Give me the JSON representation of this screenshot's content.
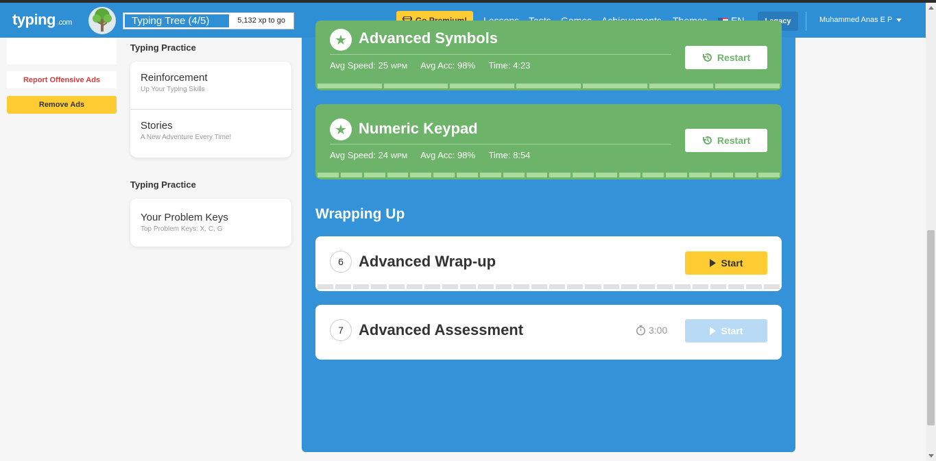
{
  "header": {
    "logo_main": "typing",
    "logo_suffix": ".com",
    "level_name": "Typing Tree (4/5)",
    "xp_progress": 0.63,
    "xp_to_go": "5,132 xp to go",
    "premium_label": "Go Premium!",
    "nav": [
      "Lessons",
      "Tests",
      "Games",
      "Achievements",
      "Themes"
    ],
    "active_nav": "Lessons",
    "language": "EN",
    "legacy_label": "Legacy",
    "user_name": "Muhammed Anas E P"
  },
  "sidebar": {
    "report_ads": "Report Offensive Ads",
    "remove_ads": "Remove Ads"
  },
  "practice": {
    "section1_label": "Typing Practice",
    "items1": [
      {
        "title": "Reinforcement",
        "subtitle": "Up Your Typing Skills"
      },
      {
        "title": "Stories",
        "subtitle": "A New Adventure Every Time!"
      }
    ],
    "section2_label": "Typing Practice",
    "items2": [
      {
        "title": "Your Problem Keys",
        "subtitle": "Top Problem Keys: X, C, G"
      }
    ]
  },
  "lessons": {
    "advanced_symbols": {
      "title": "Advanced Symbols",
      "speed_label": "Avg Speed:",
      "speed": "25",
      "speed_unit": "WPM",
      "acc_label": "Avg Acc:",
      "acc": "98%",
      "time_label": "Time:",
      "time": "4:23",
      "action": "Restart"
    },
    "numeric_keypad": {
      "title": "Numeric Keypad",
      "speed_label": "Avg Speed:",
      "speed": "24",
      "speed_unit": "WPM",
      "acc_label": "Avg Acc:",
      "acc": "98%",
      "time_label": "Time:",
      "time": "8:54",
      "action": "Restart"
    },
    "wrapping_header": "Wrapping Up",
    "wrap_up": {
      "number": "6",
      "title": "Advanced Wrap-up",
      "action": "Start"
    },
    "assessment": {
      "number": "7",
      "title": "Advanced Assessment",
      "timer": "3:00",
      "action": "Start"
    }
  },
  "colors": {
    "brand_blue": "#3392d8",
    "complete_green": "#6db46a",
    "accent_yellow": "#ffcc33"
  }
}
